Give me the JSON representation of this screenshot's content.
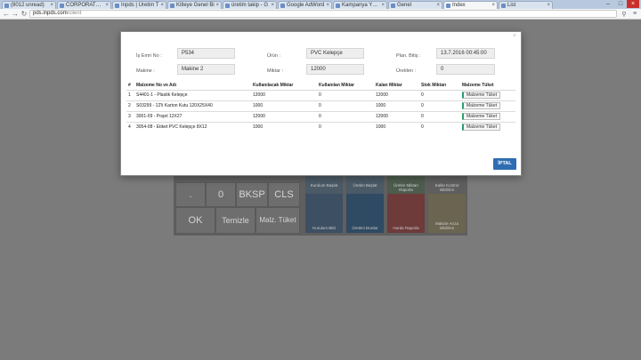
{
  "browser": {
    "tabs": [
      {
        "label": "(8012 unread)"
      },
      {
        "label": "CORPORATE ID"
      },
      {
        "label": "Inpds | Üretim T"
      },
      {
        "label": "Kitleye Genel Bi"
      },
      {
        "label": "üretim takip - G"
      },
      {
        "label": "Google AdWord"
      },
      {
        "label": "Kampanya Yönet"
      },
      {
        "label": "Genel"
      },
      {
        "label": "Index"
      },
      {
        "label": "List"
      }
    ],
    "url_host": "pds.inpds.com",
    "url_path": "/client"
  },
  "keypad": {
    "keys": [
      ".",
      "0",
      "BKSP",
      "CLS",
      "OK",
      "Temizle",
      "Malz. Tüket"
    ]
  },
  "tiles": [
    "Kurulum Başlat",
    "Üretim Başlat",
    "Üretim Miktarı Raporla",
    "Kalite Kontrol Bildirimi",
    "Kurulum Bitti",
    "Üretimi Durdur",
    "Hurda Raporla",
    "Makine Arıza Bildirimi"
  ],
  "modal": {
    "close_glyph": "×",
    "fields": {
      "is_emri_label": "İş Emri No :",
      "is_emri_value": "P534",
      "urun_label": "Ürün :",
      "urun_value": "PVC Kelepçe",
      "plan_label": "Plan. Bitiş :",
      "plan_value": "13.7.2016 00:45:00",
      "makine_label": "Makine :",
      "makine_value": "Makine 2",
      "miktar_label": "Miktar :",
      "miktar_value": "12000",
      "uretilen_label": "Üretilen :",
      "uretilen_value": "0"
    },
    "table": {
      "headers": [
        "#",
        "Malzeme No ve Adı",
        "Kullanılacak Miktar",
        "Kullanılan Miktar",
        "Kalan Miktar",
        "Stok Miktarı",
        "Malzeme Tüket"
      ],
      "rows": [
        {
          "no": "1",
          "name": "S4401-1 - Plastik Kelepçe",
          "kullanilacak": "12000",
          "kullanilan": "0",
          "kalan": "12000",
          "stok": "0",
          "button": "Malzeme Tüket"
        },
        {
          "no": "2",
          "name": "S03299 - 12'li Karton Kutu 120X25X40",
          "kullanilacak": "1000",
          "kullanilan": "0",
          "kalan": "1000",
          "stok": "0",
          "button": "Malzeme Tüket"
        },
        {
          "no": "3",
          "name": "3001-09 - Poşet 12X27",
          "kullanilacak": "12000",
          "kullanilan": "0",
          "kalan": "12000",
          "stok": "0",
          "button": "Malzeme Tüket"
        },
        {
          "no": "4",
          "name": "3054-08 - Etiket PVC Kelepçe 8X12",
          "kullanilacak": "1000",
          "kullanilan": "0",
          "kalan": "1000",
          "stok": "0",
          "button": "Malzeme Tüket"
        }
      ]
    },
    "cancel_label": "İPTAL"
  },
  "colors": {
    "accent": "#2f6db3",
    "tuket_accent": "#2e9e6e",
    "overlay": "#7b7b7b"
  }
}
